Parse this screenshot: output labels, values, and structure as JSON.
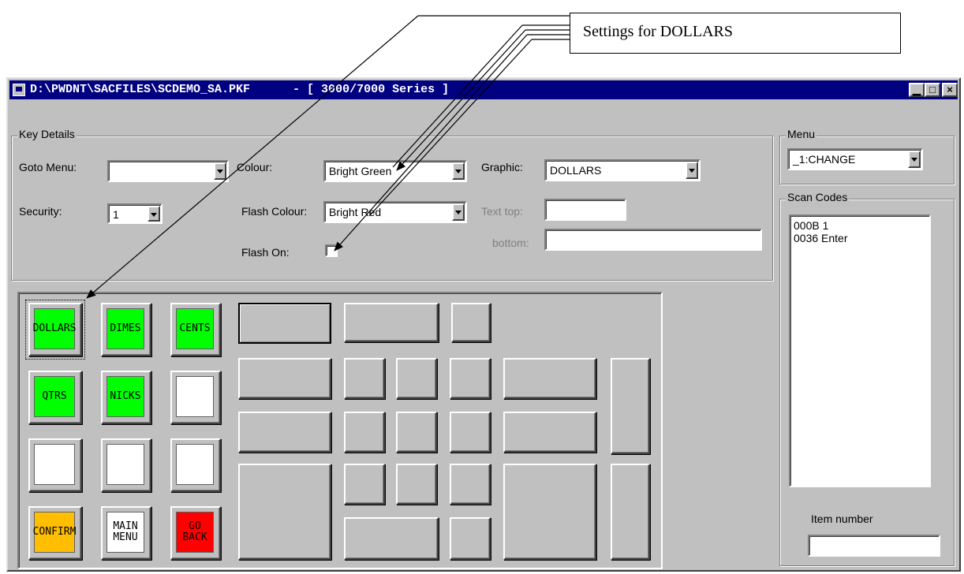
{
  "callout": {
    "text": "Settings for DOLLARS"
  },
  "window": {
    "title": "D:\\PWDNT\\SACFILES\\SCDEMO_SA.PKF      - [ 3000/7000 Series ]",
    "buttons": {
      "minimize": "▁",
      "maximize": "□",
      "close": "×"
    }
  },
  "key_details": {
    "legend": "Key Details",
    "goto_menu": {
      "label": "Goto Menu:",
      "value": ""
    },
    "security": {
      "label": "Security:",
      "value": "1"
    },
    "colour": {
      "label": "Colour:",
      "value": "Bright Green"
    },
    "flash_colour": {
      "label": "Flash Colour:",
      "value": "Bright Red"
    },
    "flash_on": {
      "label": "Flash On:",
      "checked": false
    },
    "graphic": {
      "label": "Graphic:",
      "value": "DOLLARS"
    },
    "text_top": {
      "label": "Text top:",
      "value": ""
    },
    "text_bottom": {
      "label": "bottom:",
      "value": ""
    }
  },
  "menu": {
    "legend": "Menu",
    "value": "_1:CHANGE"
  },
  "scan_codes": {
    "legend": "Scan Codes",
    "items": [
      "000B 1",
      "0036 Enter"
    ]
  },
  "item_number": {
    "label": "Item number",
    "value": ""
  },
  "keys": {
    "dollars": "DOLLARS",
    "dimes": "DIMES",
    "cents": "CENTS",
    "qtrs": "QTRS",
    "nicks": "NICKS",
    "confirm": "CONFIRM",
    "main_menu": "MAIN\nMENU",
    "go_back": "GO\nBACK"
  },
  "colors": {
    "window_bg": "#c0c0c0",
    "titlebar": "#000080",
    "key_green": "#00ff00",
    "key_orange": "#ffbf00",
    "key_red": "#ff0000",
    "key_blank": "#ffffff"
  }
}
